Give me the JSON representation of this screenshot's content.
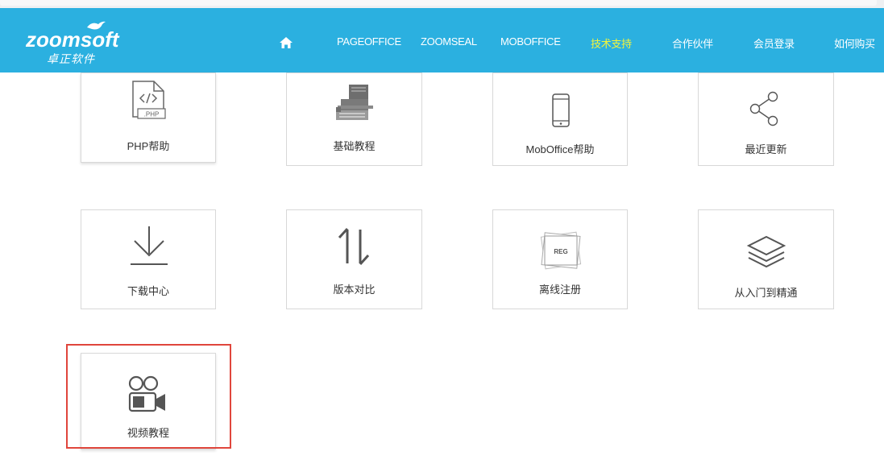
{
  "brand": {
    "logo_text": "zoomsoft",
    "logo_subtext": "卓正软件",
    "header_color": "#2bb0e0",
    "active_nav_color": "#f5f53a"
  },
  "nav": {
    "items": [
      {
        "label": "PAGEOFFICE"
      },
      {
        "label": "ZOOMSEAL"
      },
      {
        "label": "MOBOFFICE"
      },
      {
        "label": "技术支持",
        "active": true
      },
      {
        "label": "合作伙伴"
      },
      {
        "label": "会员登录"
      },
      {
        "label": "如何购买"
      }
    ]
  },
  "cards": [
    {
      "label": "PHP帮助",
      "icon": "php-file-icon"
    },
    {
      "label": "基础教程",
      "icon": "typewriter-icon"
    },
    {
      "label": "MobOffice帮助",
      "icon": "mobile-phone-icon"
    },
    {
      "label": "最近更新",
      "icon": "share-icon"
    },
    {
      "label": "下载中心",
      "icon": "download-icon"
    },
    {
      "label": "版本对比",
      "icon": "sort-arrows-icon"
    },
    {
      "label": "离线注册",
      "icon": "reg-stamp-icon",
      "icon_text": "REG"
    },
    {
      "label": "从入门到精通",
      "icon": "layers-icon"
    },
    {
      "label": "视频教程",
      "icon": "video-camera-icon"
    }
  ],
  "highlight_color": "#e0463c"
}
